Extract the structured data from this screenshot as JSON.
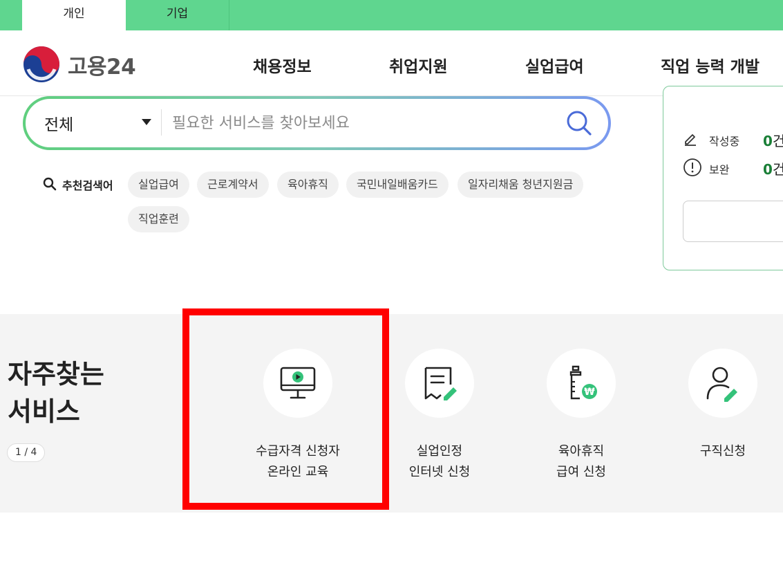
{
  "top_tabs": [
    {
      "label": "개인",
      "active": true
    },
    {
      "label": "기업",
      "active": false
    }
  ],
  "header": {
    "logo_text": "고용24",
    "nav": [
      "채용정보",
      "취업지원",
      "실업급여",
      "직업 능력 개발"
    ]
  },
  "search": {
    "scope_value": "전체",
    "placeholder": "필요한 서비스를 찾아보세요",
    "button_icon": "search-icon"
  },
  "recommended": {
    "label": "추천검색어",
    "keywords": [
      "실업급여",
      "근로계약서",
      "육아휴직",
      "국민내일배움카드",
      "일자리채움 청년지원금",
      "직업훈련"
    ]
  },
  "status_panel": {
    "rows": [
      {
        "label": "작성중",
        "count": "0",
        "unit": "건",
        "icon": "pencil-icon"
      },
      {
        "label": "보완",
        "count": "0",
        "unit": "건",
        "icon": "alert-circle-icon"
      }
    ]
  },
  "favorites": {
    "title_line1": "자주찾는",
    "title_line2": "서비스",
    "pager": "1 / 4",
    "services": [
      {
        "line1": "수급자격 신청자",
        "line2": "온라인 교육",
        "icon": "monitor-play-icon"
      },
      {
        "line1": "실업인정",
        "line2": "인터넷 신청",
        "icon": "document-edit-icon"
      },
      {
        "line1": "육아휴직",
        "line2": "급여 신청",
        "icon": "baby-bottle-won-icon"
      },
      {
        "line1": "구직신청",
        "line2": "",
        "icon": "person-edit-icon"
      }
    ]
  },
  "colors": {
    "brand_green": "#5fd68f",
    "count_green": "#1a7f37",
    "icon_accent": "#34c27a",
    "highlight": "#ff0000"
  }
}
